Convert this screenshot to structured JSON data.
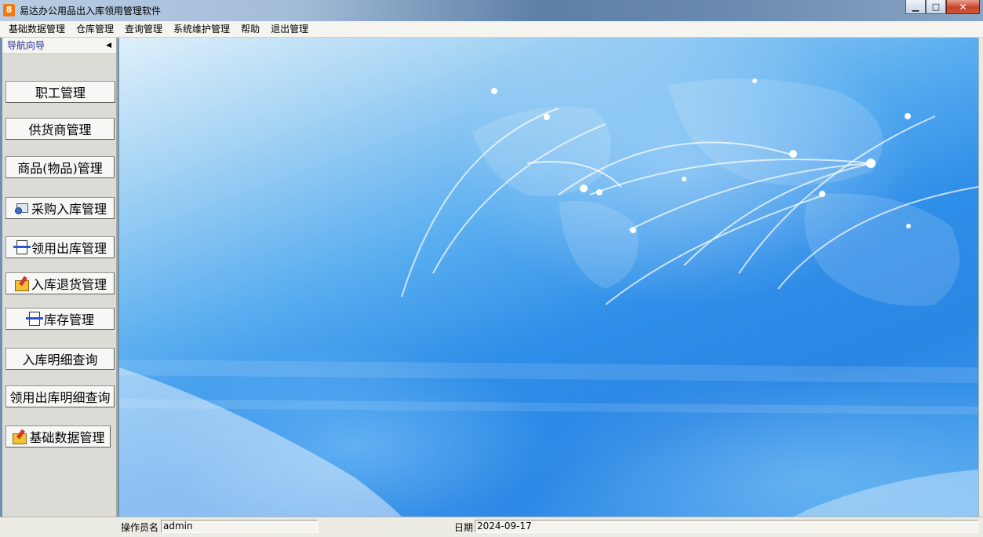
{
  "window": {
    "app_icon_text": "8",
    "title": "易达办公用品出入库领用管理软件",
    "min_symbol": "▁",
    "max_symbol": "□",
    "close_symbol": "✕"
  },
  "menu": [
    {
      "label": "基础数据管理"
    },
    {
      "label": "仓库管理"
    },
    {
      "label": "查询管理"
    },
    {
      "label": "系统维护管理"
    },
    {
      "label": "帮助"
    },
    {
      "label": "退出管理"
    }
  ],
  "sidebar": {
    "title": "导航向导",
    "collapse_symbol": "◀",
    "buttons": [
      {
        "label": "职工管理",
        "icon": ""
      },
      {
        "label": "供货商管理",
        "icon": ""
      },
      {
        "label": "商品(物品)管理",
        "icon": ""
      },
      {
        "label": "采购入库管理",
        "icon": "computer-icon"
      },
      {
        "label": "领用出库管理",
        "icon": "document-edit-icon"
      },
      {
        "label": "入库退货管理",
        "icon": "folder-edit-icon"
      },
      {
        "label": "库存管理",
        "icon": "document-edit-icon"
      },
      {
        "label": "入库明细查询",
        "icon": ""
      },
      {
        "label": "领用出库明细查询",
        "icon": ""
      },
      {
        "label": "基础数据管理",
        "icon": "folder-edit-icon"
      }
    ]
  },
  "status": {
    "operator_label": "操作员名",
    "operator_value": "admin",
    "date_label": "日期",
    "date_value": "2024-09-17"
  },
  "colors": {
    "background_blue": "#2f8ee8",
    "nav_title": "#1f2d8a",
    "close_red": "#c7432a"
  }
}
